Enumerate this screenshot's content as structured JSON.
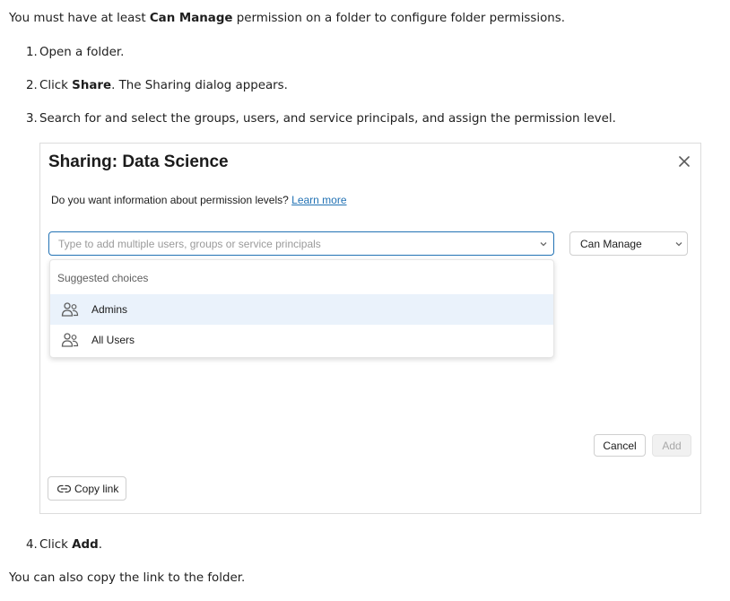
{
  "intro": {
    "before": "You must have at least ",
    "bold": "Can Manage",
    "after": " permission on a folder to configure folder permissions."
  },
  "steps": [
    {
      "num": "1.",
      "text": "Open a folder."
    },
    {
      "num": "2.",
      "pre": "Click ",
      "bold": "Share",
      "post": ". The Sharing dialog appears."
    },
    {
      "num": "3.",
      "text": "Search for and select the groups, users, and service principals, and assign the permission level."
    },
    {
      "num": "4.",
      "pre": "Click ",
      "bold": "Add",
      "post": "."
    }
  ],
  "outro": "You can also copy the link to the folder.",
  "dialog": {
    "title": "Sharing: Data Science",
    "info_text": "Do you want information about permission levels? ",
    "learn_more": "Learn more",
    "search_placeholder": "Type to add multiple users, groups or service principals",
    "permission_value": "Can Manage",
    "suggestions_header": "Suggested choices",
    "suggestions": [
      {
        "label": "Admins",
        "icon": "group-icon",
        "highlighted": true
      },
      {
        "label": "All Users",
        "icon": "group-icon",
        "highlighted": false
      }
    ],
    "cancel_label": "Cancel",
    "add_label": "Add",
    "copy_link_label": "Copy link"
  },
  "colors": {
    "accent": "#2272b4",
    "highlight": "#eaf2fb",
    "disabled_bg": "#f1f1f1"
  }
}
